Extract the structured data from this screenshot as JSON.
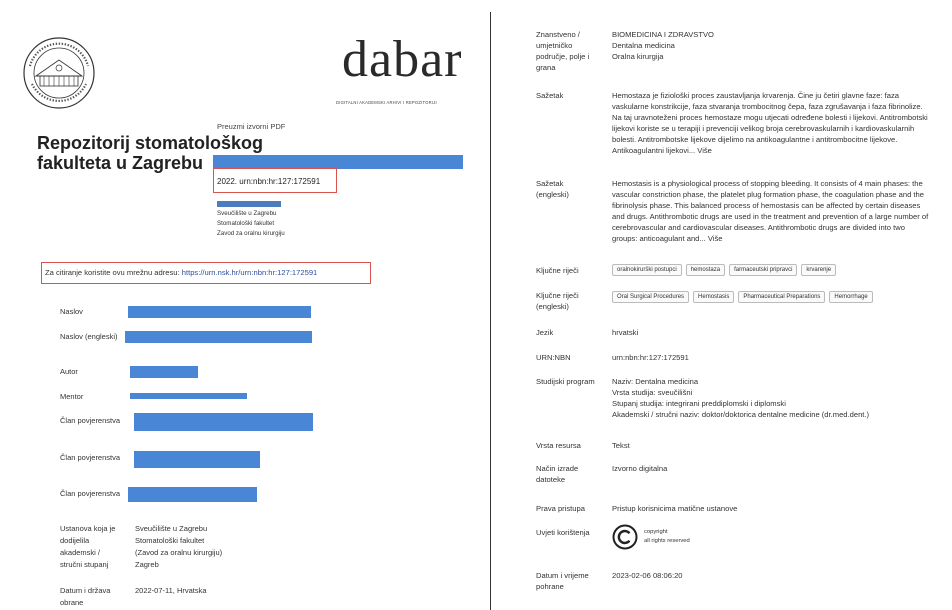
{
  "left": {
    "seal_icon": "university-seal-icon",
    "logo": {
      "text": "dabar",
      "subtitle": "DIGITALNI AKADEMSKI ARHIVI I REPOZITORIJI"
    },
    "repo_title": "Repozitorij stomatološkog fakulteta u Zagrebu",
    "pdf_link": "Preuzmi izvorni PDF",
    "urn": "2022. urn:nbn:hr:127:172591",
    "institution_lines": [
      "Sveučilište u Zagrebu",
      "Stomatološki fakultet",
      "Zavod za oralnu kirurgiju"
    ],
    "cite_label": "Za citiranje koristite ovu mrežnu adresu: ",
    "cite_link": "https://urn.nsk.hr/urn:nbn:hr:127:172591",
    "rows": {
      "naslov": "Naslov",
      "naslov_en": "Naslov (engleski)",
      "autor": "Autor",
      "mentor": "Mentor",
      "clan1": "Član povjerenstva",
      "clan2": "Član povjerenstva",
      "clan3": "Član povjerenstva",
      "ustanova": "Ustanova koja je dodijelila akademski / stručni stupanj",
      "ustanova_value": [
        "Sveučilište u Zagrebu",
        "Stomatološki fakultet",
        "(Zavod za oralnu kirurgiju)",
        "Zagreb"
      ],
      "datum": "Datum i država obrane",
      "datum_value": "2022-07-11, Hrvatska"
    }
  },
  "right": {
    "field_label": "Znanstveno / umjetničko područje, polje i grana",
    "field_value": [
      "BIOMEDICINA I ZDRAVSTVO",
      "Dentalna medicina",
      "Oralna kirurgija"
    ],
    "sazetak_label": "Sažetak",
    "sazetak_value": "Hemostaza je fiziološki proces zaustavljanja krvarenja. Čine ju četiri glavne faze: faza vaskularne konstrikcije, faza stvaranja trombocitnog čepa, faza zgrušavanja i faza fibrinolize. Na taj uravnoteženi proces hemostaze mogu utjecati određene bolesti i lijekovi. Antitrombotski lijekovi koriste se u terapiji i prevenciji velikog broja cerebrovaskularnih i kardiovaskularnih bolesti. Antitrombotske lijekove dijelimo na antikoagulantne i antitrombocitne lijekove. Antikoagulantni lijekovi... Više",
    "sazetak_en_label": "Sažetak (engleski)",
    "sazetak_en_value": "Hemostasis is a physiological process of stopping bleeding. It consists of 4 main phases: the vascular constriction phase, the platelet plug formation phase, the coagulation phase and the fibrinolysis phase. This balanced process of hemostasis can be affected by certain diseases and drugs. Antithrombotic drugs are used in the treatment and prevention of a large number of cerebrovascular and cardiovascular diseases. Antithrombotic drugs are divided into two groups: anticoagulant and... Više",
    "kljucne_label": "Ključne riječi",
    "kljucne": [
      "oralnokirurški postupci",
      "hemostaza",
      "farmaceutski pripravci",
      "krvarenje"
    ],
    "kljucne_en_label": "Ključne riječi (engleski)",
    "kljucne_en": [
      "Oral Surgical Procedures",
      "Hemostasis",
      "Pharmaceutical Preparations",
      "Hemorrhage"
    ],
    "jezik_label": "Jezik",
    "jezik_value": "hrvatski",
    "urn_label": "URN:NBN",
    "urn_value": "urn:nbn:hr:127:172591",
    "program_label": "Studijski program",
    "program_value": [
      "Naziv: Dentalna medicina",
      "Vrsta studija: sveučilišni",
      "Stupanj studija: integrirani preddiplomski i diplomski",
      "Akademski / stručni naziv: doktor/doktorica dentalne medicine (dr.med.dent.)"
    ],
    "vrsta_label": "Vrsta resursa",
    "vrsta_value": "Tekst",
    "nacin_label": "Način izrade datoteke",
    "nacin_value": "Izvorno digitalna",
    "prava_label": "Prava pristupa",
    "prava_value": "Pristup korisnicima matične ustanove",
    "uvjeti_label": "Uvjeti korištenja",
    "copyright_icon": "copyright-icon",
    "copyright_lines": [
      "copyright",
      "all rights reserved"
    ],
    "datum_pohrane_label": "Datum i vrijeme pohrane",
    "datum_pohrane_value": "2023-02-06 08:06:20"
  },
  "colors": {
    "redaction": "#4a86d6",
    "highlight_box": "#d9534f",
    "link": "#2c4ea0"
  }
}
